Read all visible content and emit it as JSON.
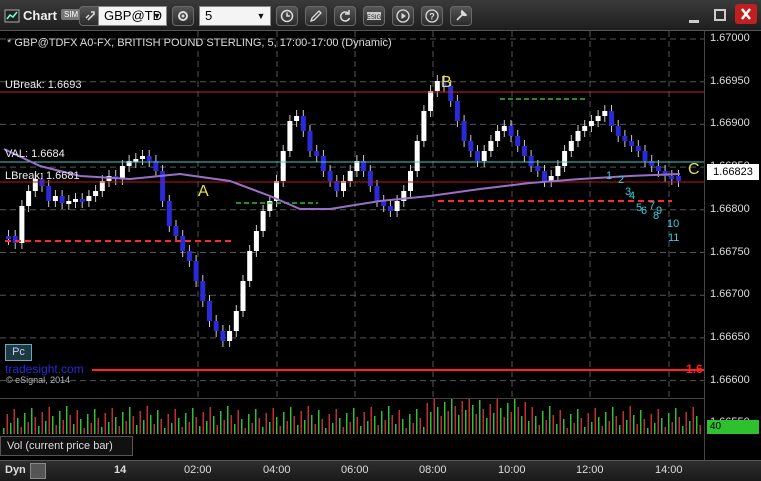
{
  "toolbar": {
    "app_title": "Chart",
    "sim_badge": "SIM",
    "symbol": "GBP@TD",
    "interval": "5",
    "icons": [
      "link-icon",
      "clock-icon",
      "pencil-icon",
      "refresh-icon",
      "esig-icon",
      "play-icon",
      "help-icon",
      "settings-icon"
    ]
  },
  "chart": {
    "title": "* GBP@TDFX A0-FX, BRITISH POUND STERLING, 5, 17:00-17:00 (Dynamic)",
    "current_price": "1.66823",
    "price_ticks": [
      "1.67000",
      "1.66950",
      "1.66900",
      "1.66850",
      "1.66800",
      "1.66750",
      "1.66700",
      "1.66650",
      "1.66600",
      "1.66550"
    ],
    "time_ticks": [
      "14",
      "02:00",
      "04:00",
      "06:00",
      "08:00",
      "10:00",
      "12:00",
      "14:00"
    ],
    "levels": {
      "ubreak": "UBreak: 1.6693",
      "val": "VAL: 1.6684",
      "lbreak": "LBreak: 1.6681",
      "low_marker": "1.6"
    },
    "markers": {
      "a": "A",
      "b": "B",
      "c": "C"
    },
    "watermark": "tradesight.com",
    "copyright": "© eSignal, 2014",
    "pc_button": "Pc",
    "seq_numbers": [
      "1",
      "2",
      "3",
      "4",
      "5",
      "6",
      "7",
      "8",
      "9",
      "10",
      "11"
    ],
    "colors": {
      "up": "#ffffff",
      "down": "#2a2ad8",
      "ubreak": "#d02020",
      "val": "#40c8c8",
      "lbreak": "#c02020",
      "ma": "#9a6fc8",
      "green": "#2ec02e",
      "cyan": "#35d0e0",
      "yellow": "#e8e050"
    }
  },
  "volume": {
    "label": "Vol (current price bar)",
    "value": "40"
  },
  "bottombar": {
    "dyn_label": "Dyn"
  }
}
